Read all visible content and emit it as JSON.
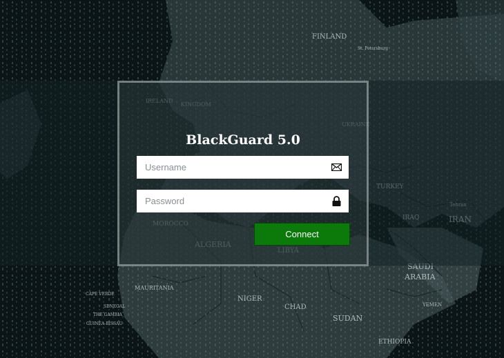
{
  "app": {
    "title": "BlackGuard 5.0"
  },
  "login": {
    "username_placeholder": "Username",
    "username_value": "",
    "username_icon": "envelope-icon",
    "password_placeholder": "Password",
    "password_value": "",
    "password_icon": "lock-icon",
    "connect_label": "Connect",
    "connect_color": "#0b7a0b"
  },
  "background": {
    "map_labels": [
      "FINLAND",
      "St. Petersburg",
      "IRELAND",
      "KINGDOM",
      "UKRAINE",
      "TURKEY",
      "IRAQ",
      "IRAN",
      "Tehran",
      "MOROCCO",
      "ALGERIA",
      "LIBYA",
      "SAUDI ARABIA",
      "YEMEN",
      "MAURITANIA",
      "NIGER",
      "CHAD",
      "SUDAN",
      "ETHIOPIA",
      "CAPE VERDE",
      "SENEGAL",
      "THE GAMBIA",
      "GUINEA-BISSAU"
    ]
  }
}
